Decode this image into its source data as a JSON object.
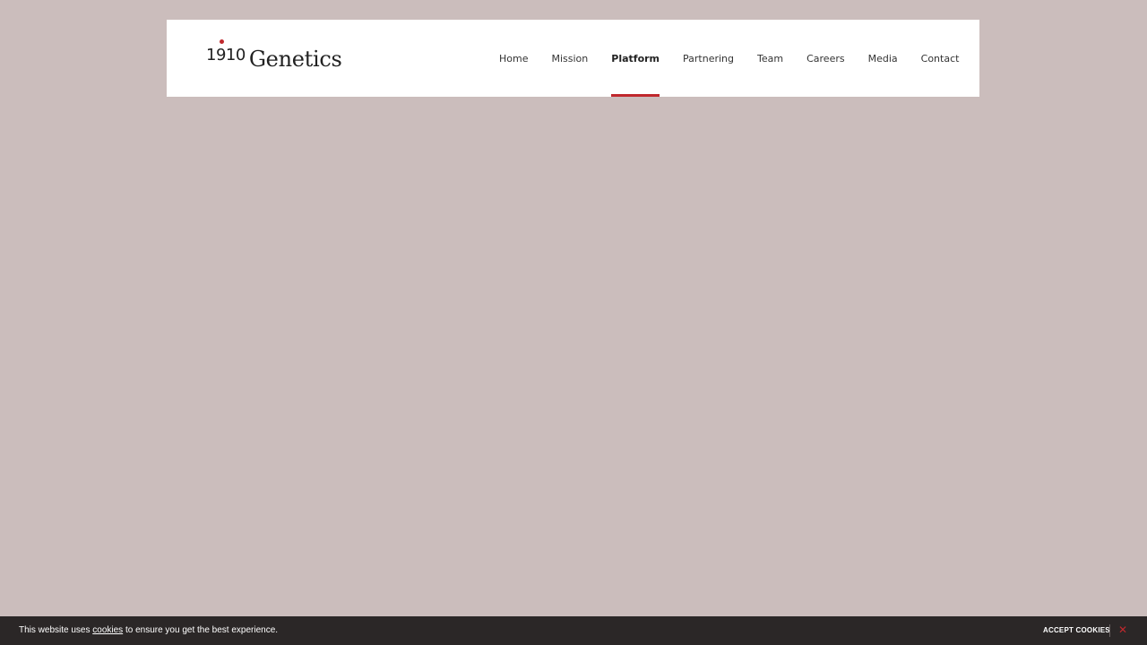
{
  "header": {
    "logo_number": "1910",
    "logo_word": "Genetics"
  },
  "nav": {
    "items": [
      {
        "label": "Home"
      },
      {
        "label": "Mission"
      },
      {
        "label": "Platform",
        "active": true
      },
      {
        "label": "Partnering"
      },
      {
        "label": "Team"
      },
      {
        "label": "Careers"
      },
      {
        "label": "Media"
      },
      {
        "label": "Contact"
      }
    ]
  },
  "cookie_bar": {
    "text_before": "This website uses ",
    "link_text": "cookies",
    "text_after": " to ensure you get the best experience.",
    "accept_label": "ACCEPT COOKIES",
    "close_label": "✕"
  },
  "colors": {
    "background": "#cbbdbc",
    "accent": "#c0282d",
    "cookie_bar": "#2b2727"
  }
}
